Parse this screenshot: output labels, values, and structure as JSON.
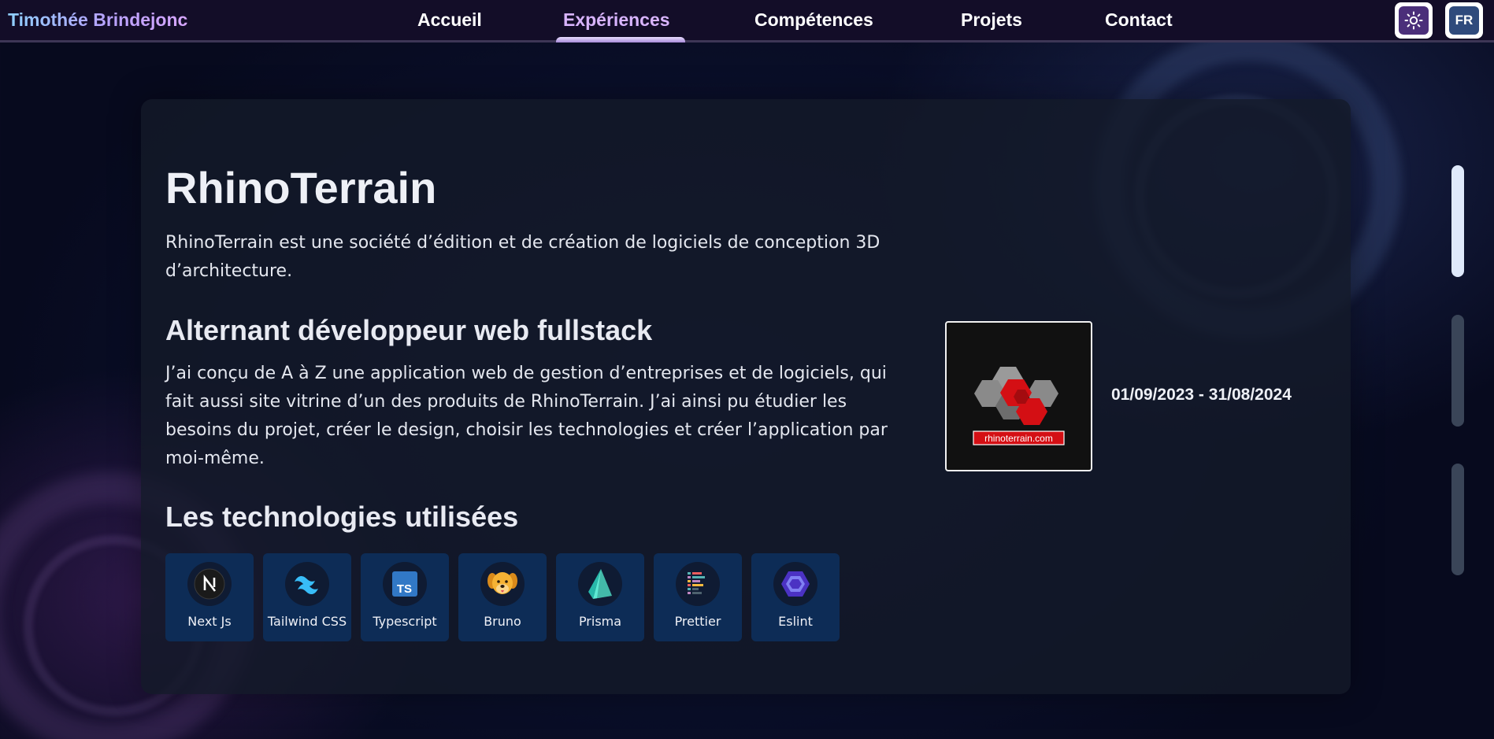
{
  "nav": {
    "brand": "Timothée Brindejonc",
    "links": [
      "Accueil",
      "Expériences",
      "Compétences",
      "Projets",
      "Contact"
    ],
    "active_index": 1,
    "lang_label": "FR",
    "theme_icon": "sun-icon"
  },
  "experience": {
    "company": "RhinoTerrain",
    "company_description": "RhinoTerrain est une société d’édition et de création de logiciels de conception 3D d’architecture.",
    "role": "Alternant développeur web fullstack",
    "role_description": "J’ai conçu de A à Z une application web de gestion d’entreprises et de logiciels, qui fait aussi site vitrine d’un des produits de RhinoTerrain. J’ai ainsi pu étudier les besoins du projet, créer le design, choisir les technologies et créer l’application par moi-même.",
    "logo_caption": "rhinoterrain.com",
    "dates": "01/09/2023 - 31/08/2024",
    "tech_title": "Les technologies utilisées",
    "technologies": [
      {
        "label": "Next Js",
        "icon": "nextjs-icon"
      },
      {
        "label": "Tailwind CSS",
        "icon": "tailwind-icon"
      },
      {
        "label": "Typescript",
        "icon": "typescript-icon"
      },
      {
        "label": "Bruno",
        "icon": "bruno-icon"
      },
      {
        "label": "Prisma",
        "icon": "prisma-icon"
      },
      {
        "label": "Prettier",
        "icon": "prettier-icon"
      },
      {
        "label": "Eslint",
        "icon": "eslint-icon"
      }
    ]
  },
  "scroll": {
    "sections": 3,
    "active_index": 0
  },
  "colors": {
    "nav_bg": "#130d28",
    "active_link": "#d8b4fe",
    "card_bg": "#141a28",
    "tech_bg": "#0d2c56",
    "logo_red": "#d40f14"
  }
}
